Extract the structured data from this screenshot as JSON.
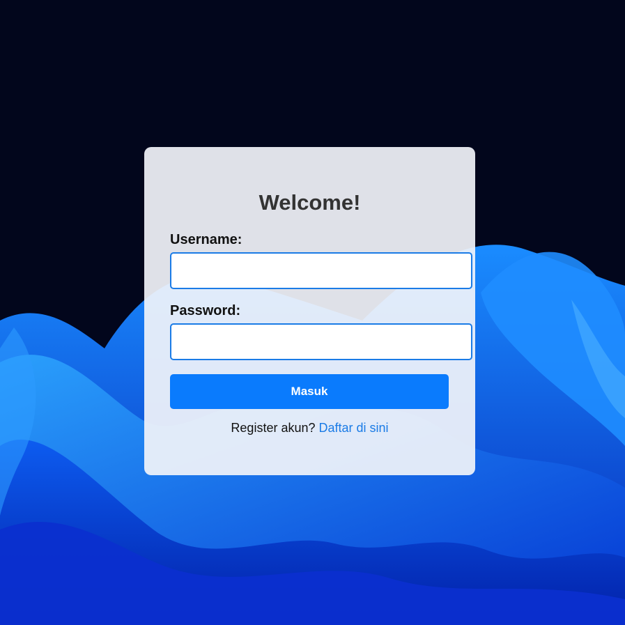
{
  "login": {
    "title": "Welcome!",
    "username_label": "Username:",
    "username_value": "",
    "password_label": "Password:",
    "password_value": "",
    "submit_label": "Masuk",
    "register_prompt": "Register akun?",
    "register_link": "Daftar di sini"
  },
  "colors": {
    "background_top": "#02061c",
    "wave_blue": "#0a4de0",
    "accent": "#0a7bfd",
    "link": "#1a7be6"
  }
}
